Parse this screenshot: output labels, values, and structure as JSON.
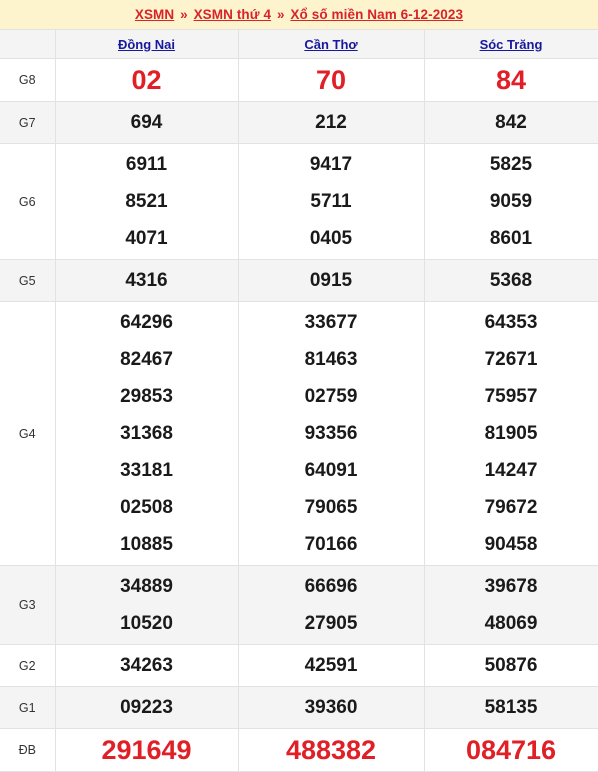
{
  "breadcrumb": {
    "items": [
      {
        "label": "XSMN",
        "link": true
      },
      {
        "label": "XSMN thứ 4",
        "link": true
      },
      {
        "label": "Xổ số miền Nam 6-12-2023",
        "link": true
      }
    ],
    "separator": "»"
  },
  "colors": {
    "breadcrumb_background": "#fdf3cd",
    "breadcrumb_text": "#d8232a",
    "header_text": "#17189c",
    "header_background": "#f4f4f4",
    "row_shade": "#f4f4f4",
    "row_plain": "#ffffff",
    "number_text": "#1a1a1a",
    "highlight_number_text": "#e01f26",
    "border": "#e2e2e2"
  },
  "table": {
    "corner_label": "",
    "columns": [
      {
        "label": "Đồng Nai"
      },
      {
        "label": "Cần Thơ"
      },
      {
        "label": "Sóc Trăng"
      }
    ],
    "rows": [
      {
        "prize": "G8",
        "shade": false,
        "big": true,
        "cells": [
          [
            "02"
          ],
          [
            "70"
          ],
          [
            "84"
          ]
        ]
      },
      {
        "prize": "G7",
        "shade": true,
        "big": false,
        "cells": [
          [
            "694"
          ],
          [
            "212"
          ],
          [
            "842"
          ]
        ]
      },
      {
        "prize": "G6",
        "shade": false,
        "big": false,
        "cells": [
          [
            "6911",
            "8521",
            "4071"
          ],
          [
            "9417",
            "5711",
            "0405"
          ],
          [
            "5825",
            "9059",
            "8601"
          ]
        ]
      },
      {
        "prize": "G5",
        "shade": true,
        "big": false,
        "cells": [
          [
            "4316"
          ],
          [
            "0915"
          ],
          [
            "5368"
          ]
        ]
      },
      {
        "prize": "G4",
        "shade": false,
        "big": false,
        "cells": [
          [
            "64296",
            "82467",
            "29853",
            "31368",
            "33181",
            "02508",
            "10885"
          ],
          [
            "33677",
            "81463",
            "02759",
            "93356",
            "64091",
            "79065",
            "70166"
          ],
          [
            "64353",
            "72671",
            "75957",
            "81905",
            "14247",
            "79672",
            "90458"
          ]
        ]
      },
      {
        "prize": "G3",
        "shade": true,
        "big": false,
        "cells": [
          [
            "34889",
            "10520"
          ],
          [
            "66696",
            "27905"
          ],
          [
            "39678",
            "48069"
          ]
        ]
      },
      {
        "prize": "G2",
        "shade": false,
        "big": false,
        "cells": [
          [
            "34263"
          ],
          [
            "42591"
          ],
          [
            "50876"
          ]
        ]
      },
      {
        "prize": "G1",
        "shade": true,
        "big": false,
        "cells": [
          [
            "09223"
          ],
          [
            "39360"
          ],
          [
            "58135"
          ]
        ]
      },
      {
        "prize": "ĐB",
        "shade": false,
        "big": true,
        "cells": [
          [
            "291649"
          ],
          [
            "488382"
          ],
          [
            "084716"
          ]
        ]
      }
    ]
  }
}
